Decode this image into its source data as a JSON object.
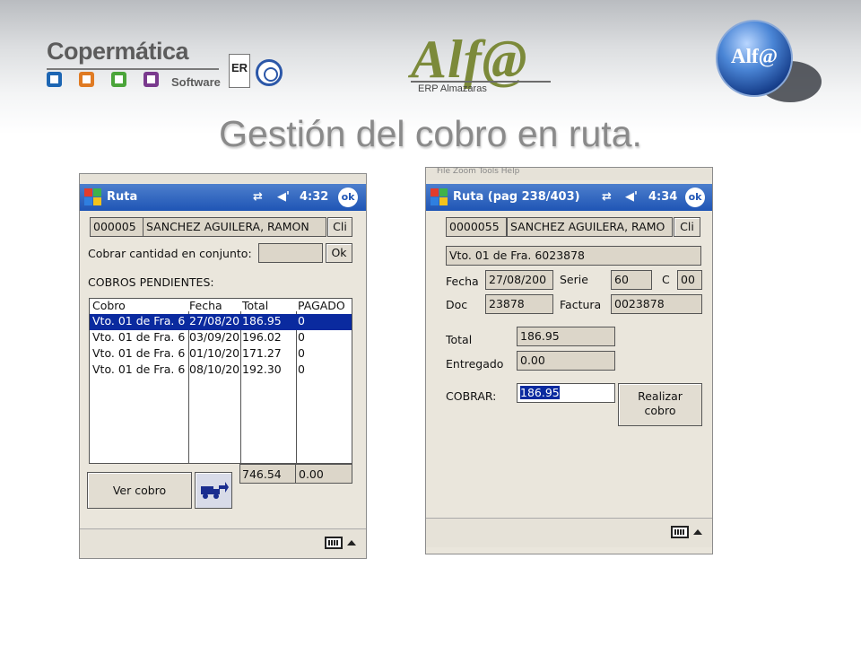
{
  "header": {
    "company_logo_text": "Copermática",
    "company_logo_sub": "Software",
    "cert_er_text": "ER",
    "product_logo_text": "Alf@",
    "product_logo_sub": "ERP Almazaras",
    "globe_text": "Alf@",
    "title": "Gestión del cobro en ruta."
  },
  "colors": {
    "square_1": "#1d66b3",
    "square_2": "#e07b23",
    "square_3": "#4ba53a",
    "square_4": "#7a3a8e",
    "titlebar_blue": "#1f55b5",
    "selection_blue": "#0a2a9f"
  },
  "left_screen": {
    "app_title": "Ruta",
    "time": "4:32",
    "ok_label": "ok",
    "client_code": "000005",
    "client_name": "SANCHEZ AGUILERA, RAMON",
    "client_button": "Cli",
    "collect_together_label": "Cobrar cantidad en conjunto:",
    "collect_together_value": "",
    "ok_button": "Ok",
    "pending_label": "COBROS PENDIENTES:",
    "columns": [
      "Cobro",
      "Fecha",
      "Total",
      "PAGADO"
    ],
    "rows": [
      {
        "cobro": "Vto. 01 de Fra. 6",
        "fecha": "27/08/20",
        "total": "186.95",
        "pagado": "0",
        "selected": true
      },
      {
        "cobro": "Vto. 01 de Fra. 6",
        "fecha": "03/09/20",
        "total": "196.02",
        "pagado": "0",
        "selected": false
      },
      {
        "cobro": "Vto. 01 de Fra. 6",
        "fecha": "01/10/20",
        "total": "171.27",
        "pagado": "0",
        "selected": false
      },
      {
        "cobro": "Vto. 01 de Fra. 6",
        "fecha": "08/10/20",
        "total": "192.30",
        "pagado": "0",
        "selected": false
      }
    ],
    "sum_total": "746.54",
    "sum_paid": "0.00",
    "view_button": "Ver cobro",
    "truck_icon": "delivery-truck-icon"
  },
  "right_screen": {
    "menu_text": "File   Zoom   Tools   Help",
    "app_title": "Ruta (pag 238/403)",
    "time": "4:34",
    "ok_label": "ok",
    "client_code": "0000055",
    "client_name": "SANCHEZ AGUILERA, RAMO",
    "client_button": "Cli",
    "invoice_desc": "Vto. 01 de Fra. 6023878",
    "fecha_label": "Fecha",
    "fecha_value": "27/08/200",
    "serie_label": "Serie",
    "serie_value": "60",
    "c_label": "C",
    "c_value": "00",
    "doc_label": "Doc",
    "doc_value": "23878",
    "factura_label": "Factura",
    "factura_value": "0023878",
    "total_label": "Total",
    "total_value": "186.95",
    "entregado_label": "Entregado",
    "entregado_value": "0.00",
    "cobrar_label": "COBRAR:",
    "cobrar_value": "186.95",
    "realizar_line1": "Realizar",
    "realizar_line2": "cobro"
  }
}
